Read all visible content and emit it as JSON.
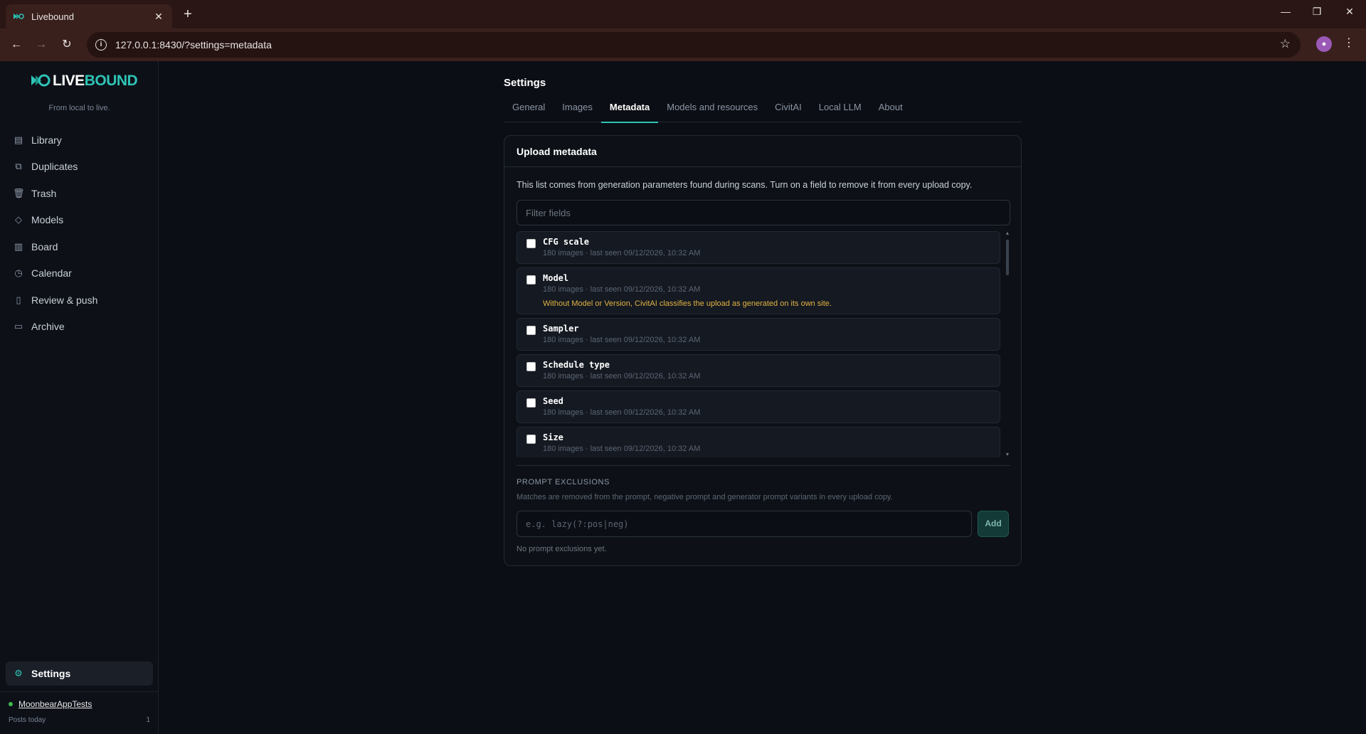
{
  "browser": {
    "tab_title": "Livebound",
    "url": "127.0.0.1:8430/?settings=metadata"
  },
  "app": {
    "logo_prefix": "LIVE",
    "logo_suffix": "BOUND",
    "tagline": "From local to live.",
    "accent_color": "#2ec4b6"
  },
  "sidebar": {
    "items": [
      {
        "label": "Library",
        "icon": "library-icon"
      },
      {
        "label": "Duplicates",
        "icon": "duplicates-icon"
      },
      {
        "label": "Trash",
        "icon": "trash-icon"
      },
      {
        "label": "Models",
        "icon": "models-icon"
      },
      {
        "label": "Board",
        "icon": "board-icon"
      },
      {
        "label": "Calendar",
        "icon": "calendar-icon"
      },
      {
        "label": "Review & push",
        "icon": "review-icon"
      },
      {
        "label": "Archive",
        "icon": "archive-icon"
      }
    ],
    "settings_label": "Settings",
    "account": {
      "name": "MoonbearAppTests",
      "posts_label": "Posts today",
      "posts_count": "1"
    }
  },
  "settings": {
    "title": "Settings",
    "tabs": [
      "General",
      "Images",
      "Metadata",
      "Models and resources",
      "CivitAI",
      "Local LLM",
      "About"
    ],
    "active_tab": "Metadata"
  },
  "upload_metadata": {
    "title": "Upload metadata",
    "description": "This list comes from generation parameters found during scans. Turn on a field to remove it from every upload copy.",
    "filter_placeholder": "Filter fields",
    "fields": [
      {
        "name": "CFG scale",
        "meta": "180 images · last seen 09/12/2026, 10:32 AM",
        "warning": ""
      },
      {
        "name": "Model",
        "meta": "180 images · last seen 09/12/2026, 10:32 AM",
        "warning": "Without Model or Version, CivitAI classifies the upload as generated on its own site."
      },
      {
        "name": "Sampler",
        "meta": "180 images · last seen 09/12/2026, 10:32 AM",
        "warning": ""
      },
      {
        "name": "Schedule type",
        "meta": "180 images · last seen 09/12/2026, 10:32 AM",
        "warning": ""
      },
      {
        "name": "Seed",
        "meta": "180 images · last seen 09/12/2026, 10:32 AM",
        "warning": ""
      },
      {
        "name": "Size",
        "meta": "180 images · last seen 09/12/2026, 10:32 AM",
        "warning": ""
      }
    ]
  },
  "prompt_exclusions": {
    "title": "PROMPT EXCLUSIONS",
    "description": "Matches are removed from the prompt, negative prompt and generator prompt variants in every upload copy.",
    "input_placeholder": "e.g. lazy(?:pos|neg)",
    "add_label": "Add",
    "empty_text": "No prompt exclusions yet."
  }
}
